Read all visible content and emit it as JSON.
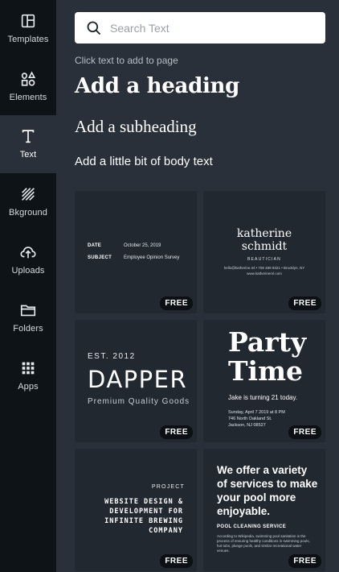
{
  "sidebar": {
    "items": [
      {
        "label": "Templates",
        "icon": "templates-icon"
      },
      {
        "label": "Elements",
        "icon": "elements-icon"
      },
      {
        "label": "Text",
        "icon": "text-icon",
        "active": true
      },
      {
        "label": "Bkground",
        "icon": "background-icon"
      },
      {
        "label": "Uploads",
        "icon": "upload-icon"
      },
      {
        "label": "Folders",
        "icon": "folder-icon"
      },
      {
        "label": "Apps",
        "icon": "apps-icon"
      }
    ]
  },
  "search": {
    "placeholder": "Search Text"
  },
  "text_panel": {
    "hint": "Click text to add to page",
    "heading": "Add a heading",
    "subheading": "Add a subheading",
    "body": "Add a little bit of body text"
  },
  "badge": "FREE",
  "templates": {
    "card1": {
      "date_key": "DATE",
      "date_val": "October 25, 2019",
      "subject_key": "SUBJECT",
      "subject_val": "Employee Opinion Survey"
    },
    "card2": {
      "name_line1": "katherine",
      "name_line2": "schmidt",
      "title": "BEAUTICIAN",
      "info_line1": "hello@katherine.ml • 708 489 9321 • Brooklyn, NY",
      "info_line2": "www.katherineml.com"
    },
    "card3": {
      "est": "EST. 2012",
      "brand": "DAPPER",
      "tagline": "Premium Quality Goods"
    },
    "card4": {
      "title_line1": "Party",
      "title_line2": "Time",
      "line": "Jake is turning 21 today.",
      "detail1": "Sunday, April 7 2019 at 8 PM",
      "detail2": "746 North Oakland St.",
      "detail3": "Jackson, NJ 08527"
    },
    "card5": {
      "label": "PROJECT",
      "line1": "WEBSITE DESIGN &",
      "line2": "DEVELOPMENT FOR",
      "line3": "INFINITE BREWING",
      "line4": "COMPANY"
    },
    "card6": {
      "headline": "We offer a variety of services to make your pool more enjoyable.",
      "service": "POOL CLEANING SERVICE",
      "body": "According to Wikipedia, swimming pool sanitation is the process of ensuring healthy conditions in swimming pools, hot tubs, plunge pools, and similar recreational water venues."
    }
  }
}
